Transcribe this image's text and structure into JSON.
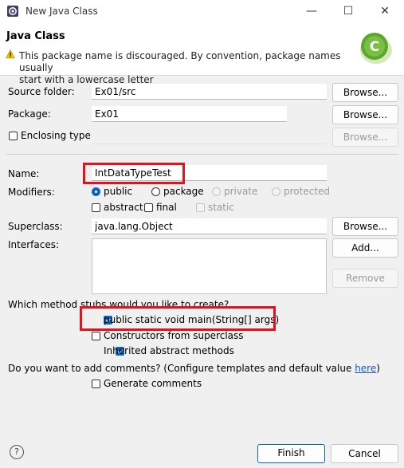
{
  "window": {
    "title": "New Java Class",
    "minimize": "—",
    "maximize": "☐",
    "close": "✕"
  },
  "header": {
    "title": "Java Class",
    "message_line1": "This package name is discouraged. By convention, package names usually",
    "message_line2": "start with a lowercase letter",
    "badge_letter": "C"
  },
  "form": {
    "source_folder": {
      "label": "Source folder:",
      "value": "Ex01/src",
      "button": "Browse..."
    },
    "package": {
      "label": "Package:",
      "value": "Ex01",
      "button": "Browse..."
    },
    "enclosing": {
      "label": "Enclosing type:",
      "value": "",
      "button": "Browse..."
    },
    "name": {
      "label": "Name:",
      "value": "IntDataTypeTest"
    },
    "modifiers": {
      "label": "Modifiers:",
      "public": "public",
      "package": "package",
      "private": "private",
      "protected": "protected",
      "abstract": "abstract",
      "final": "final",
      "static": "static"
    },
    "superclass": {
      "label": "Superclass:",
      "value": "java.lang.Object",
      "button": "Browse..."
    },
    "interfaces": {
      "label": "Interfaces:",
      "add_button": "Add...",
      "remove_button": "Remove"
    }
  },
  "stubs": {
    "question": "Which method stubs would you like to create?",
    "main": "public static void main(String[] args)",
    "constructors": "Constructors from superclass",
    "inherited": "Inherited abstract methods"
  },
  "comments": {
    "question_prefix": "Do you want to add comments? (Configure templates and default value ",
    "link": "here",
    "question_suffix": ")",
    "generate": "Generate comments"
  },
  "footer": {
    "help": "?",
    "finish": "Finish",
    "cancel": "Cancel"
  },
  "colors": {
    "highlight": "#e0141e",
    "accent": "#0a64c2",
    "link": "#1a55cc"
  }
}
